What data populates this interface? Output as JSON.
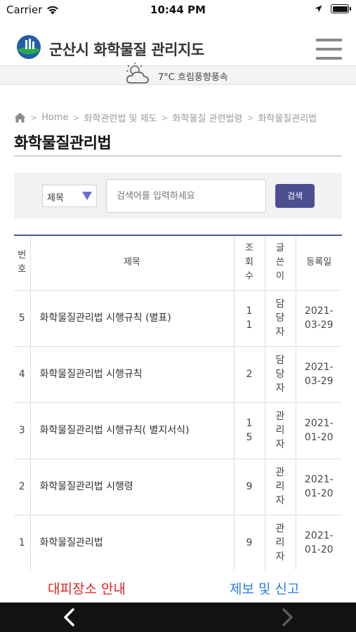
{
  "status_bar": {
    "carrier": "Carrier",
    "time": "10:44 PM"
  },
  "header": {
    "title": "군산시 화학물질 관리지도"
  },
  "weather": {
    "text": "7°C 흐림풍향풍속"
  },
  "breadcrumb": {
    "items": [
      "Home",
      "화학관련법 및 제도",
      "화학물질 관련법령",
      "화학물질관리법"
    ]
  },
  "page": {
    "title": "화학물질관리법"
  },
  "search": {
    "select_value": "제목",
    "placeholder": "검색어를 입력하세요",
    "button_label": "검색"
  },
  "table": {
    "headers": [
      "번호",
      "제목",
      "조회수",
      "글쓴이",
      "등록일"
    ],
    "rows": [
      {
        "no": "5",
        "title": "화학물질관리법 시행규칙 (별표)",
        "views": "11",
        "author": "담당자",
        "date": "2021-03-29"
      },
      {
        "no": "4",
        "title": "화학물질관리법 시행규칙",
        "views": "2",
        "author": "담당자",
        "date": "2021-03-29"
      },
      {
        "no": "3",
        "title": "화학물질관리법 시행규칙( 별지서식)",
        "views": "15",
        "author": "관리자",
        "date": "2021-01-20"
      },
      {
        "no": "2",
        "title": "화학물질관리법 시행령",
        "views": "9",
        "author": "관리자",
        "date": "2021-01-20"
      },
      {
        "no": "1",
        "title": "화학물질관리법",
        "views": "9",
        "author": "관리자",
        "date": "2021-01-20"
      }
    ]
  },
  "bottom_links": {
    "left": "대피장소 안내",
    "right": "제보 및 신고"
  },
  "colors": {
    "table_top_border": "#4a5a8a",
    "search_button": "#4b4f8f",
    "link_left": "#e02020",
    "link_right": "#2a7de0"
  }
}
